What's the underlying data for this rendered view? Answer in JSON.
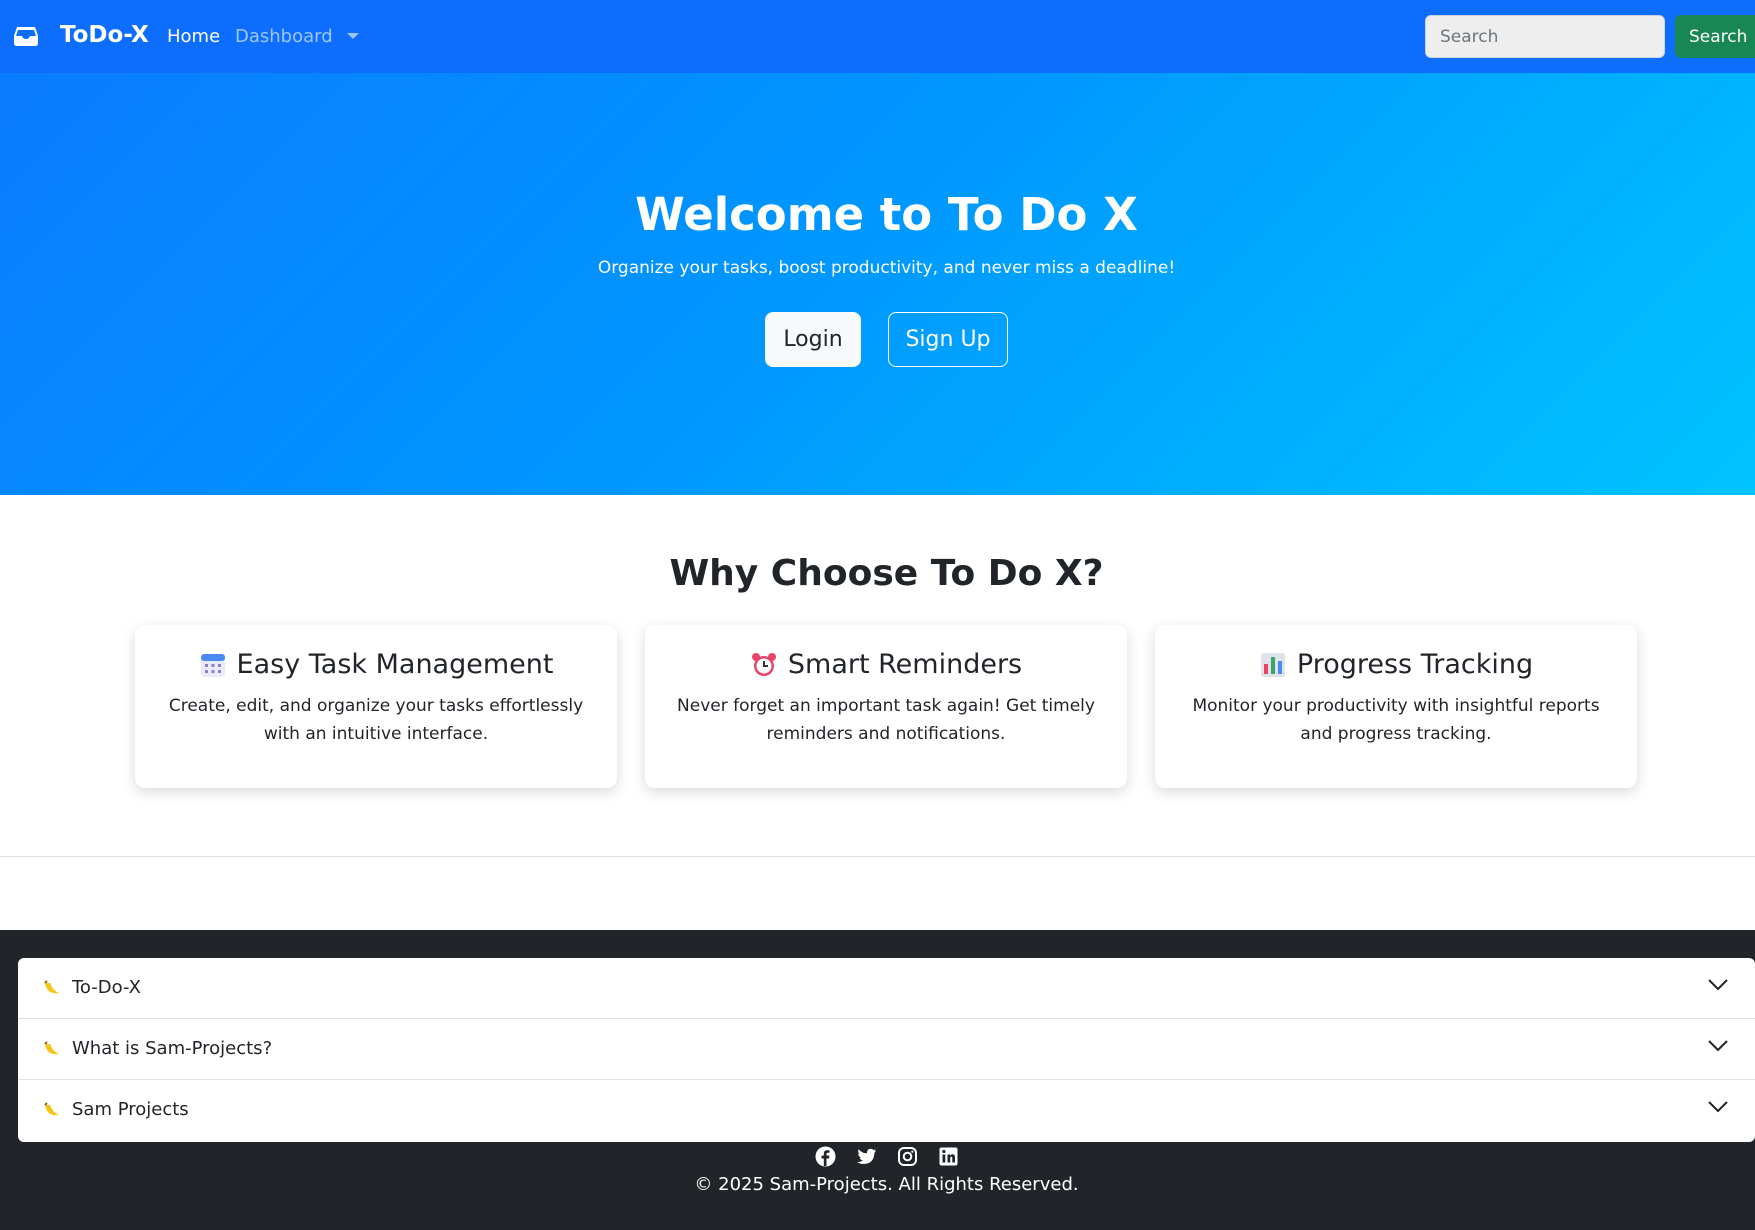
{
  "navbar": {
    "brand": "ToDo-X",
    "home": "Home",
    "dashboard": "Dashboard",
    "search_placeholder": "Search",
    "search_button": "Search"
  },
  "hero": {
    "title": "Welcome to To Do X",
    "subtitle": "Organize your tasks, boost productivity, and never miss a deadline!",
    "login": "Login",
    "signup": "Sign Up"
  },
  "features": {
    "title": "Why Choose To Do X?",
    "cards": [
      {
        "icon": "calendar-icon",
        "title": "Easy Task Management",
        "text": "Create, edit, and organize your tasks effortlessly with an intuitive interface."
      },
      {
        "icon": "alarm-clock-icon",
        "title": "Smart Reminders",
        "text": "Never forget an important task again! Get timely reminders and notifications."
      },
      {
        "icon": "bar-chart-icon",
        "title": "Progress Tracking",
        "text": "Monitor your productivity with insightful reports and progress tracking."
      }
    ]
  },
  "footer": {
    "accordion": [
      {
        "icon": "banana-icon",
        "label": "To-Do-X"
      },
      {
        "icon": "banana-icon",
        "label": "What is Sam-Projects?"
      },
      {
        "icon": "banana-icon",
        "label": "Sam Projects"
      }
    ],
    "social": [
      "facebook-icon",
      "twitter-icon",
      "instagram-icon",
      "linkedin-icon"
    ],
    "copyright": "© 2025 Sam-Projects. All Rights Reserved."
  },
  "colors": {
    "primary": "#0d6efd",
    "success": "#198754",
    "footer_bg": "#212529"
  }
}
